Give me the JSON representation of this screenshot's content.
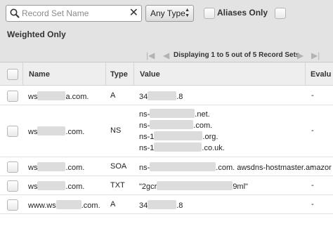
{
  "toolbar": {
    "search_placeholder": "Record Set Name",
    "clear_symbol": "✕",
    "type_select_value": "Any Type",
    "aliases_label": "Aliases Only",
    "weighted_label": "Weighted Only",
    "pager_info": "Displaying 1 to 5 out of 5 Record Sets"
  },
  "columns": {
    "name": "Name",
    "type": "Type",
    "value": "Value",
    "evaluate": "Evalu"
  },
  "rows": [
    {
      "name_a": "ws",
      "name_b": "a.com.",
      "type": "A",
      "values": [
        {
          "a": "34",
          "b": ".8"
        }
      ],
      "evaluate": "-"
    },
    {
      "name_a": "ws",
      "name_b": ".com.",
      "type": "NS",
      "values": [
        {
          "a": "ns-",
          "b": ".net."
        },
        {
          "a": "ns-",
          "b": ".com."
        },
        {
          "a": "ns-1",
          "b": ".org."
        },
        {
          "a": "ns-1",
          "b": ".co.uk."
        }
      ],
      "evaluate": "-"
    },
    {
      "name_a": "ws",
      "name_b": ".com.",
      "type": "SOA",
      "values": [
        {
          "a": "ns-",
          "b": ".com. awsdns-hostmaster.amazor"
        }
      ],
      "evaluate": "-"
    },
    {
      "name_a": "ws",
      "name_b": ".com.",
      "type": "TXT",
      "values": [
        {
          "a": "\"2gcr",
          "b": "9ml\""
        }
      ],
      "evaluate": "-"
    },
    {
      "name_a": "www.ws",
      "name_b": ".com.",
      "type": "A",
      "values": [
        {
          "a": "34",
          "b": ".8"
        }
      ],
      "evaluate": "-"
    }
  ],
  "icons": {
    "search": "magnifier-icon",
    "select_arrows": "up-down-arrows-icon",
    "first": "first-page-icon",
    "prev": "previous-page-icon",
    "next": "next-page-icon",
    "last": "last-page-icon"
  }
}
